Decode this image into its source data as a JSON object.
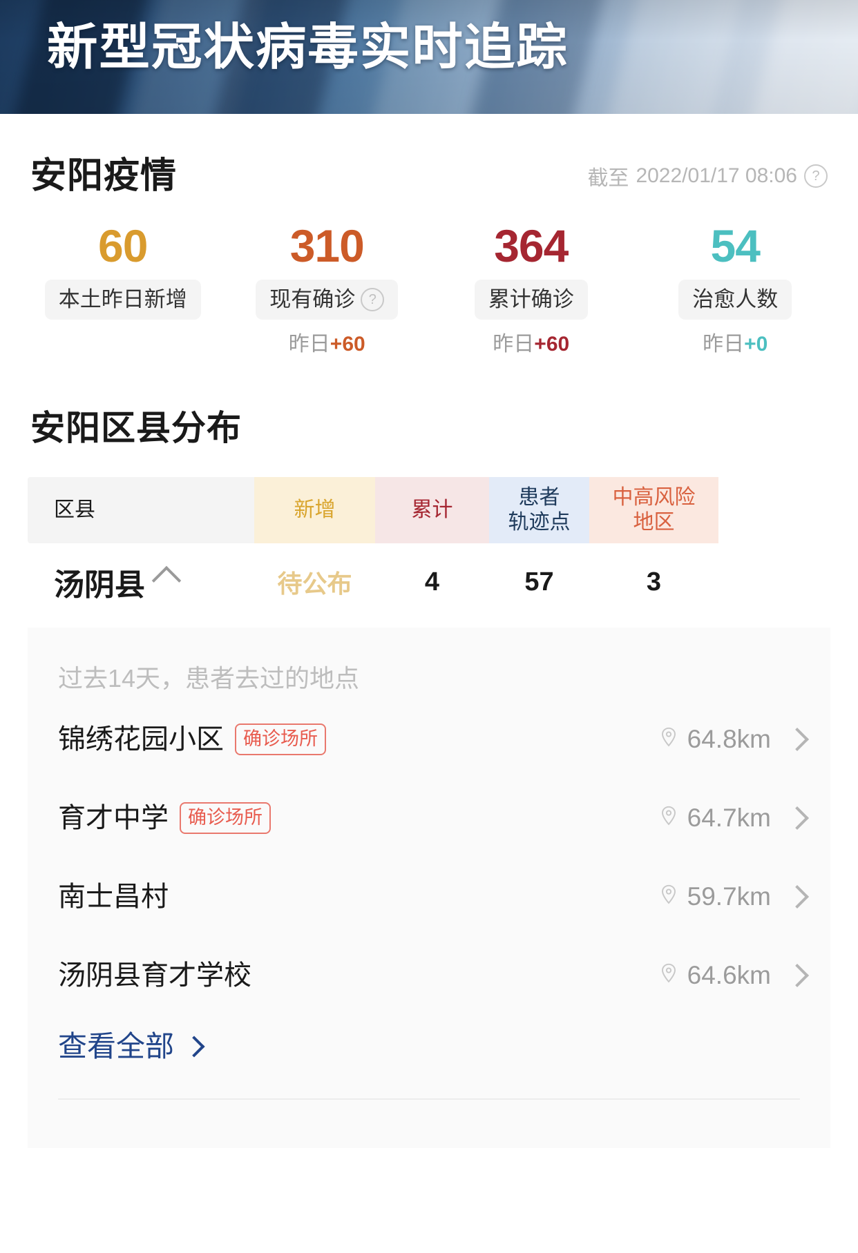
{
  "banner": {
    "title": "新型冠状病毒实时追踪"
  },
  "overview": {
    "title": "安阳疫情",
    "updated_prefix": "截至",
    "updated_time": "2022/01/17 08:06",
    "help_icon": "question-circle-icon",
    "stats": [
      {
        "value": "60",
        "label": "本土昨日新增",
        "color": "#d99b2e",
        "has_help_icon": false,
        "delta_prefix": "",
        "delta_value": ""
      },
      {
        "value": "310",
        "label": "现有确诊",
        "color": "#cc5b28",
        "has_help_icon": true,
        "delta_prefix": "昨日",
        "delta_value": "+60"
      },
      {
        "value": "364",
        "label": "累计确诊",
        "color": "#a52631",
        "has_help_icon": false,
        "delta_prefix": "昨日",
        "delta_value": "+60"
      },
      {
        "value": "54",
        "label": "治愈人数",
        "color": "#4cbfc0",
        "has_help_icon": false,
        "delta_prefix": "昨日",
        "delta_value": "+0"
      }
    ]
  },
  "district_section": {
    "title": "安阳区县分布",
    "columns": [
      {
        "label": "区县",
        "bg": "#f4f4f4",
        "color": "#1a1a1a"
      },
      {
        "label": "新增",
        "bg": "#fbf0d8",
        "color": "#d9a52e"
      },
      {
        "label": "累计",
        "bg": "#f6e6e6",
        "color": "#a52631"
      },
      {
        "label_line1": "患者",
        "label_line2": "轨迹点",
        "bg": "#e3ebf8",
        "color": "#1f3b5c"
      },
      {
        "label_line1": "中高风险",
        "label_line2": "地区",
        "bg": "#fbe8e0",
        "color": "#d9613f"
      }
    ],
    "rows": [
      {
        "name": "汤阴县",
        "expanded": true,
        "caret_icon": "chevron-up-icon",
        "new_cases": "待公布",
        "total": "4",
        "track_points": "57",
        "risk_areas": "3"
      }
    ],
    "detail": {
      "heading": "过去14天，患者去过的地点",
      "pin_icon": "map-pin-icon",
      "chevron_icon": "chevron-right-icon",
      "places": [
        {
          "name": "锦绣花园小区",
          "tag": "确诊场所",
          "distance": "64.8km"
        },
        {
          "name": "育才中学",
          "tag": "确诊场所",
          "distance": "64.7km"
        },
        {
          "name": "南士昌村",
          "tag": "",
          "distance": "59.7km"
        },
        {
          "name": "汤阴县育才学校",
          "tag": "",
          "distance": "64.6km"
        }
      ],
      "view_all": "查看全部"
    }
  }
}
